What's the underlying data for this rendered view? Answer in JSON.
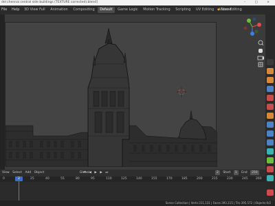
{
  "window": {
    "title": "del chennai central side buildings (TEXTURE corrected).blend]",
    "controls": [
      "–",
      "□",
      "×"
    ]
  },
  "menubar": {
    "items": [
      "File",
      "Help"
    ]
  },
  "workspaces": {
    "tabs": [
      "3D View Full",
      "Animation",
      "Compositing",
      "Default",
      "Game Logic",
      "Motion Tracking",
      "Scripting",
      "UV Editing",
      "Video Editing"
    ],
    "active": "Default"
  },
  "scene": {
    "label": "Scene"
  },
  "viewport_header": {
    "menu": [
      "View",
      "Select",
      "Add",
      "Object"
    ],
    "pivot": "Global"
  },
  "timeline": {
    "menu": [
      "View",
      "Marker"
    ],
    "current_frame": "2",
    "ticks": [
      "0",
      "25",
      "40",
      "55",
      "80",
      "95",
      "110",
      "125",
      "140",
      "155",
      "170",
      "185",
      "200",
      "215",
      "230",
      "245",
      "260"
    ],
    "start_label": "Start",
    "start_value": "1",
    "end_label": "End",
    "end_value": "250",
    "frame_value": "2"
  },
  "statusbar": {
    "text": "Scene Collection | Verts:311,131 | Faces:393,115 | Tris:395,572 | Objects:0/2"
  },
  "colors": {
    "accent_blue": "#4a7fd6",
    "active_tab": "#4b4b4b",
    "background": "#1d1d1d"
  }
}
